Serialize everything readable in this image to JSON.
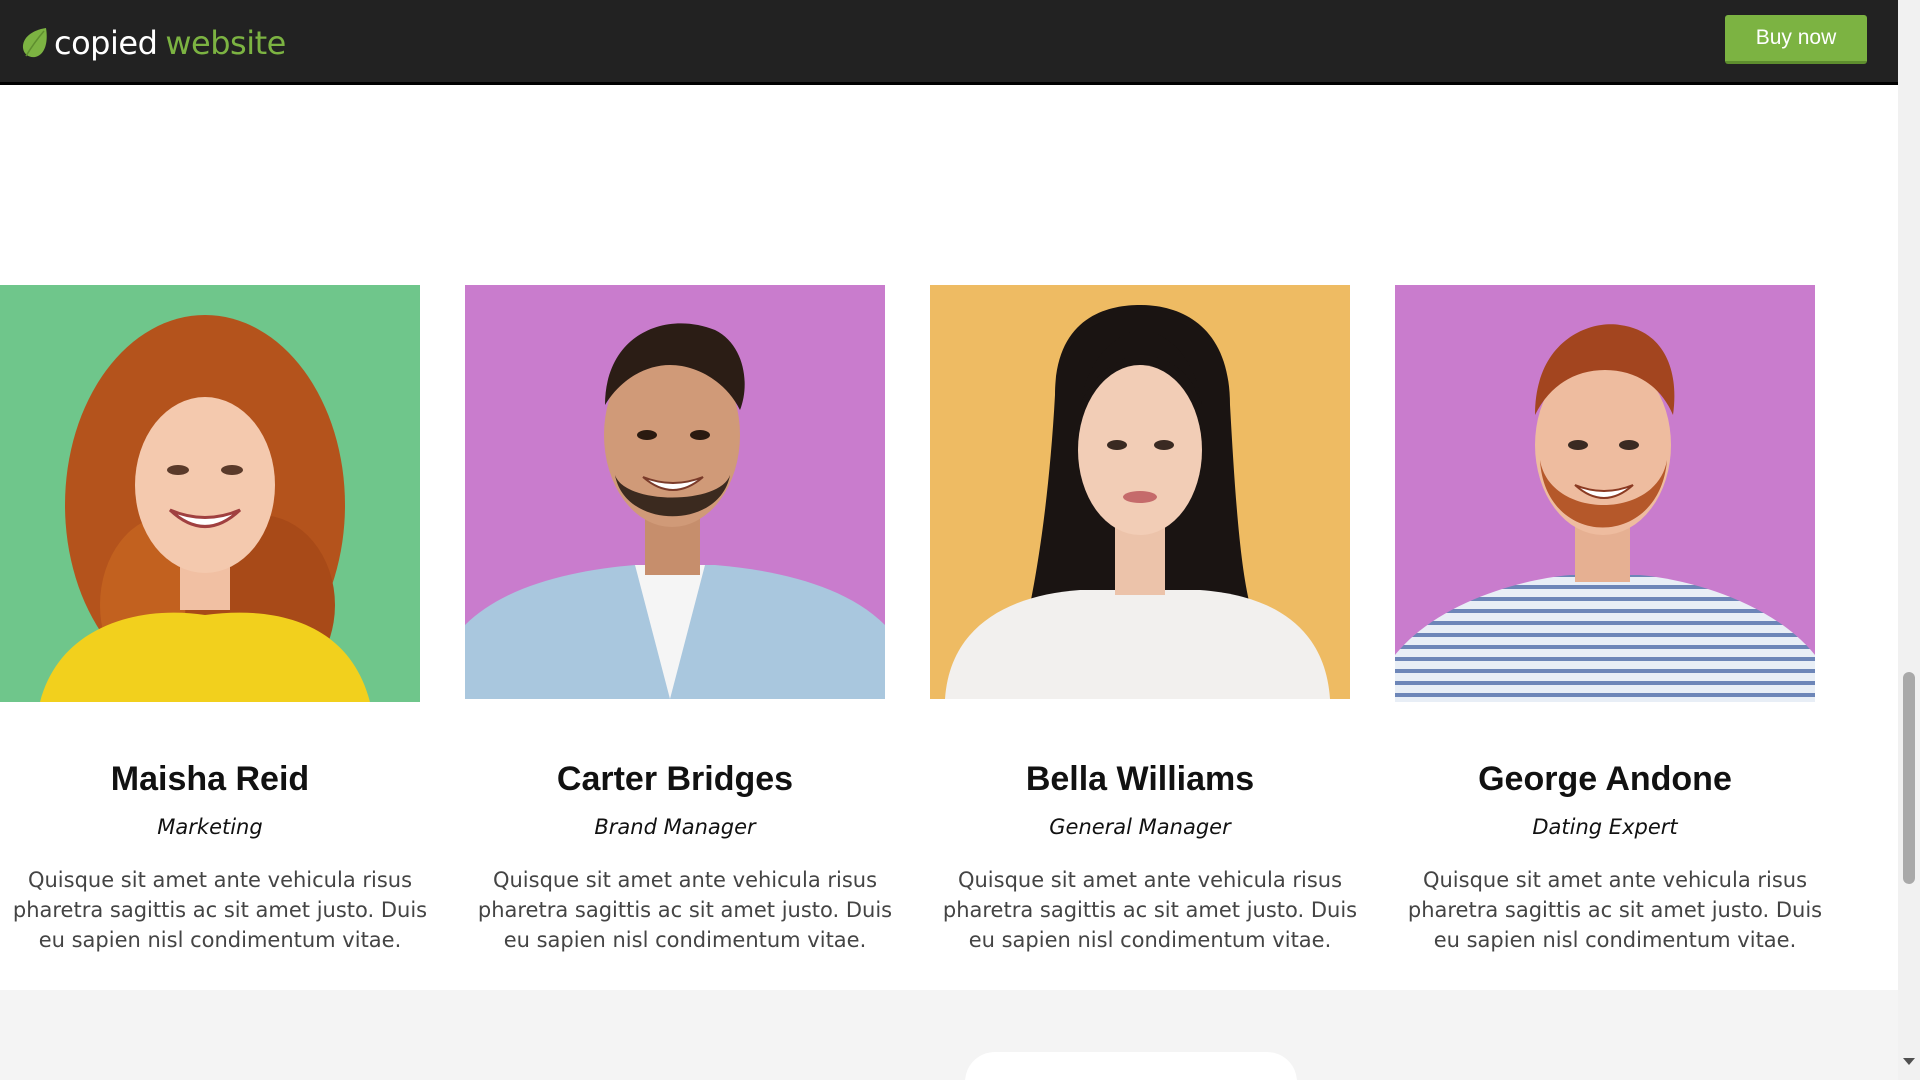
{
  "header": {
    "logo": {
      "word1": "copied",
      "word2": "website",
      "icon": "leaf-icon",
      "accent_color": "#7cb342"
    },
    "buy_label": "Buy now"
  },
  "team": [
    {
      "name": "Maisha Reid",
      "role": "Marketing",
      "description": "Quisque sit amet ante vehicula risus pharetra sagittis ac sit amet justo. Duis eu sapien nisl condimentum vitae.",
      "bg_color": "#6fc68b"
    },
    {
      "name": "Carter Bridges",
      "role": "Brand Manager",
      "description": "Quisque sit amet ante vehicula risus pharetra sagittis ac sit amet justo. Duis eu sapien nisl condimentum vitae.",
      "bg_color": "#c97ccd"
    },
    {
      "name": "Bella Williams",
      "role": "General Manager",
      "description": "Quisque sit amet ante vehicula risus pharetra sagittis ac sit amet justo. Duis eu sapien nisl condimentum vitae.",
      "bg_color": "#eebb63"
    },
    {
      "name": "George Andone",
      "role": "Dating Expert",
      "description": "Quisque sit amet ante vehicula risus pharetra sagittis ac sit amet justo. Duis eu sapien nisl condimentum vitae.",
      "bg_color": "#c97ccd"
    }
  ],
  "colors": {
    "header_bg": "#222222",
    "button_bg": "#7cb342",
    "section_gray": "#f4f4f4"
  }
}
